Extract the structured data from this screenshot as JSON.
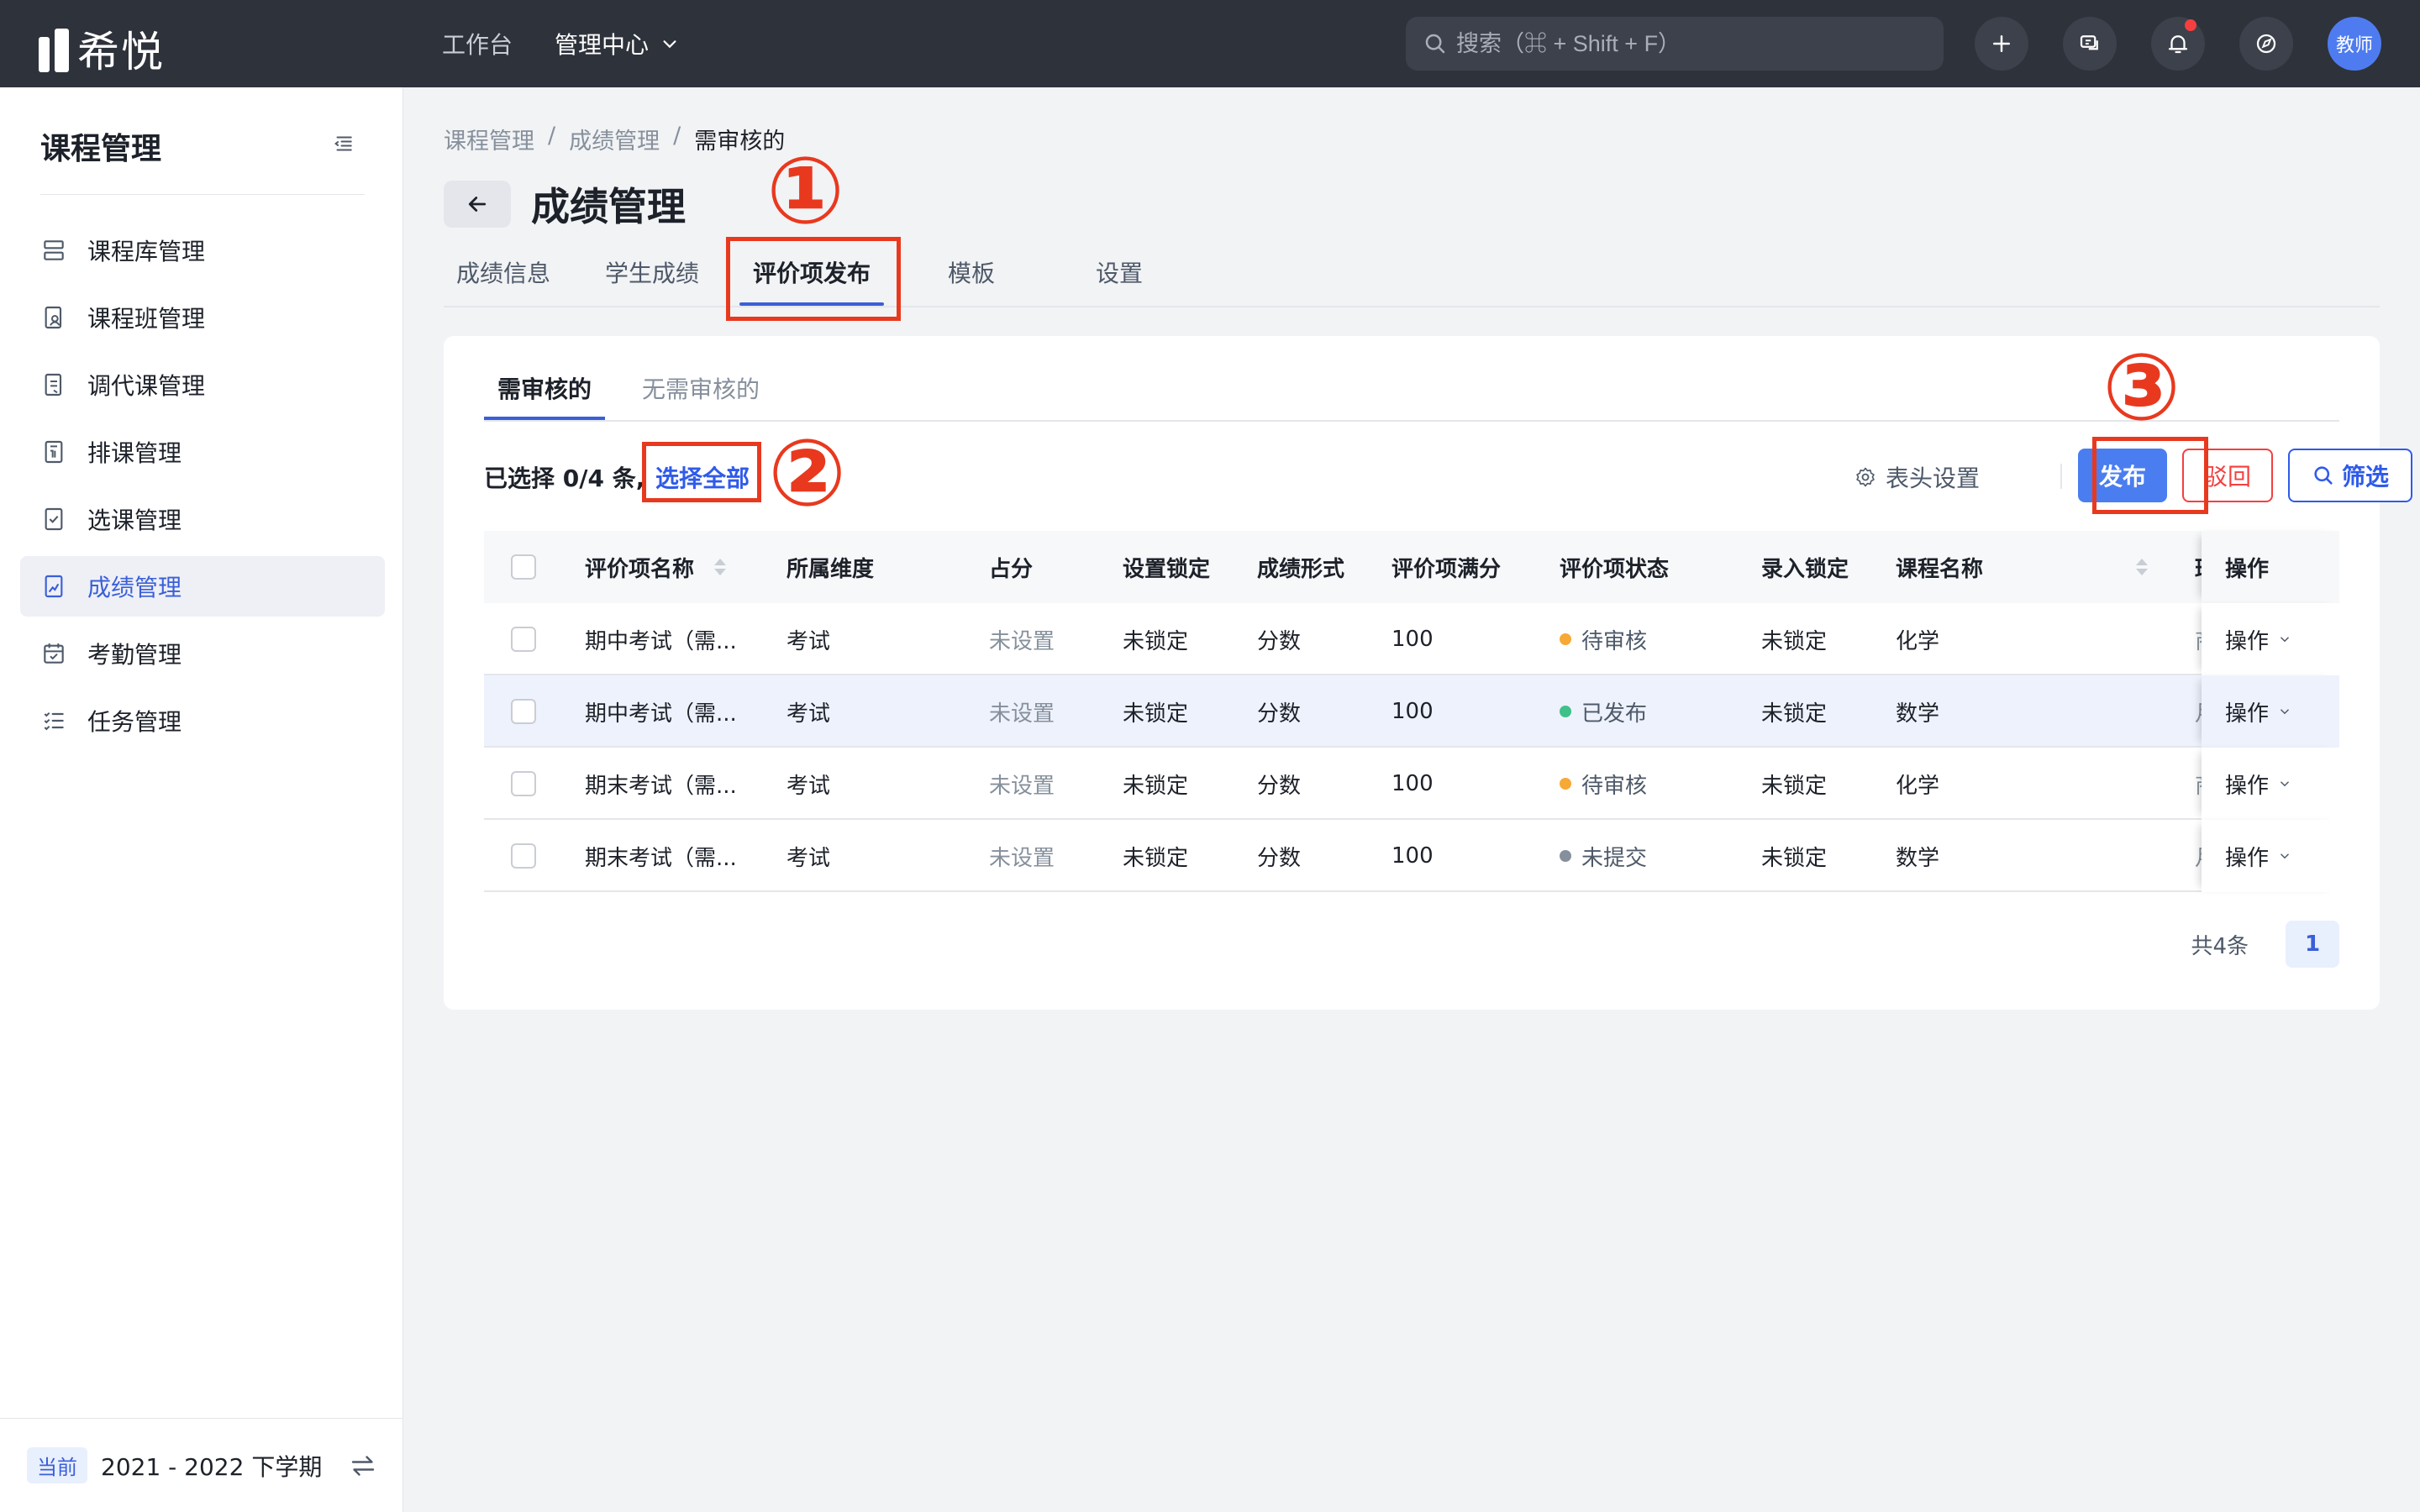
{
  "topbar": {
    "logo_text": "希悦",
    "nav": [
      {
        "label": "工作台"
      },
      {
        "label": "管理中心"
      }
    ],
    "search_placeholder": "搜索（⌘ + Shift + F）",
    "avatar_label": "教师",
    "icons": [
      "plus-icon",
      "message-icon",
      "bell-icon",
      "compass-icon"
    ],
    "notification_dot_color": "#f53f3f"
  },
  "sidebar": {
    "title": "课程管理",
    "items": [
      {
        "label": "课程库管理",
        "icon": "course-library-icon"
      },
      {
        "label": "课程班管理",
        "icon": "class-icon"
      },
      {
        "label": "调代课管理",
        "icon": "substitute-icon"
      },
      {
        "label": "排课管理",
        "icon": "schedule-icon"
      },
      {
        "label": "选课管理",
        "icon": "selection-icon"
      },
      {
        "label": "成绩管理",
        "icon": "grade-icon",
        "active": true
      },
      {
        "label": "考勤管理",
        "icon": "attendance-icon"
      },
      {
        "label": "任务管理",
        "icon": "task-icon"
      }
    ],
    "footer": {
      "tag": "当前",
      "term": "2021 - 2022 下学期"
    }
  },
  "breadcrumb": {
    "items": [
      "课程管理",
      "成绩管理",
      "需审核的"
    ],
    "separator": "/"
  },
  "page": {
    "title": "成绩管理",
    "tabs": [
      "成绩信息",
      "学生成绩",
      "评价项发布",
      "模板",
      "设置"
    ],
    "active_tab": "评价项发布"
  },
  "card": {
    "subtabs": [
      "需审核的",
      "无需审核的"
    ],
    "toolbar": {
      "selected_text": "已选择 0/4 条,",
      "select_all": "选择全部",
      "header_settings": "表头设置",
      "publish": "发布",
      "reject": "驳回",
      "filter": "筛选"
    },
    "table": {
      "columns": [
        "评价项名称",
        "所属维度",
        "占分",
        "设置锁定",
        "成绩形式",
        "评价项满分",
        "评价项状态",
        "录入锁定",
        "课程名称",
        "操作"
      ],
      "rows": [
        {
          "name": "期中考试（需...",
          "dimension": "考试",
          "score": "未设置",
          "set_lock": "未锁定",
          "form": "分数",
          "full": "100",
          "status": "待审核",
          "status_color": "#f7a935",
          "entry_lock": "未锁定",
          "course": "化学",
          "clipped": "商",
          "op": "操作"
        },
        {
          "name": "期中考试（需...",
          "dimension": "考试",
          "score": "未设置",
          "set_lock": "未锁定",
          "form": "分数",
          "full": "100",
          "status": "已发布",
          "status_color": "#3ec08a",
          "entry_lock": "未锁定",
          "course": "数学",
          "clipped": "月",
          "op": "操作"
        },
        {
          "name": "期末考试（需...",
          "dimension": "考试",
          "score": "未设置",
          "set_lock": "未锁定",
          "form": "分数",
          "full": "100",
          "status": "待审核",
          "status_color": "#f7a935",
          "entry_lock": "未锁定",
          "course": "化学",
          "clipped": "商",
          "op": "操作"
        },
        {
          "name": "期末考试（需...",
          "dimension": "考试",
          "score": "未设置",
          "set_lock": "未锁定",
          "form": "分数",
          "full": "100",
          "status": "未提交",
          "status_color": "#86909c",
          "entry_lock": "未锁定",
          "course": "数学",
          "clipped": "月",
          "op": "操作"
        }
      ],
      "clipped_header": "班"
    },
    "pager": {
      "total": "共4条",
      "page": "1"
    }
  },
  "annotations": [
    "①",
    "②",
    "③"
  ],
  "colors": {
    "accent": "#3a5fd9",
    "annotation": "#e8391f",
    "danger": "#f53f3f"
  }
}
